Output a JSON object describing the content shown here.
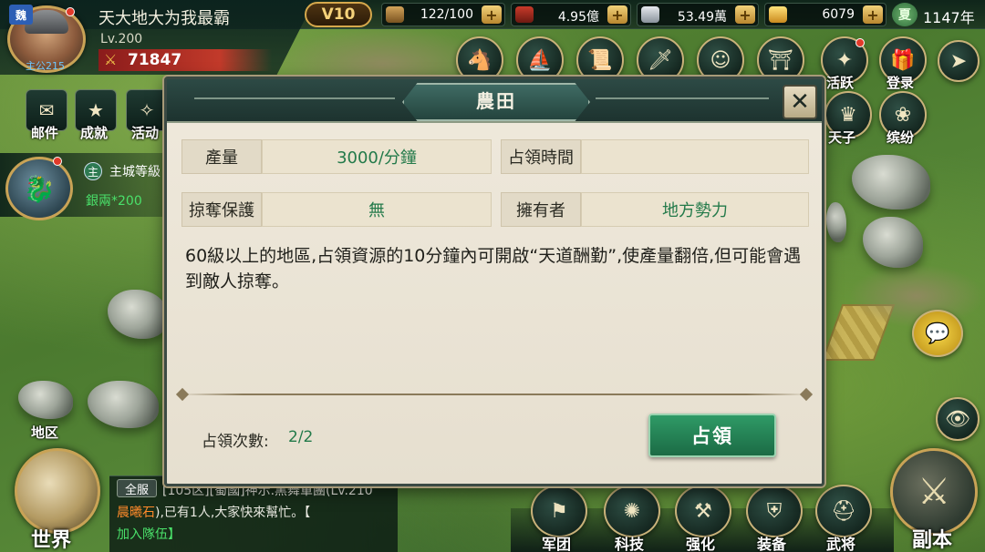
{
  "player": {
    "kingdom": "魏",
    "avatar_tag": "主公215",
    "name": "天大地大为我最霸",
    "level": "Lv.200",
    "power": "71847"
  },
  "resources": {
    "vip": "V10",
    "stamina": "122/100",
    "copper": "4.95億",
    "silver": "53.49萬",
    "gold": "6079",
    "season": "夏",
    "year": "1147年"
  },
  "top_icons": [
    {
      "name": "activity",
      "label": "活跃"
    },
    {
      "name": "login",
      "label": "登录"
    },
    {
      "name": "son-of-heaven",
      "label": "天子"
    },
    {
      "name": "colorful",
      "label": "缤纷"
    }
  ],
  "left_menu": [
    {
      "label": "邮件"
    },
    {
      "label": "成就"
    },
    {
      "label": "活动"
    }
  ],
  "quest": {
    "badge": "主",
    "title": "主城等級",
    "reward": "銀兩*200"
  },
  "region_label": "地区",
  "world_label": "世界",
  "dungeon_label": "副本",
  "chat": {
    "tab": "全服",
    "line1": "[105区][蜀國]神示.黑舞軍團(Lv.210",
    "line2_highlight": "晨曦石",
    "line2_rest": "),已有1人,大家快來幫忙。【",
    "line3": "加入隊伍】"
  },
  "bottom_nav": [
    {
      "label": "军团"
    },
    {
      "label": "科技"
    },
    {
      "label": "强化"
    },
    {
      "label": "装备"
    },
    {
      "label": "武将"
    }
  ],
  "dialog": {
    "title": "農田",
    "close_symbol": "✕",
    "rows": [
      {
        "label": "產量",
        "value": "3000/分鐘"
      },
      {
        "label": "占領時間",
        "value": ""
      },
      {
        "label": "掠奪保護",
        "value": "無"
      },
      {
        "label": "擁有者",
        "value": "地方勢力"
      }
    ],
    "description": "60級以上的地區,占領資源的10分鐘內可開啟“天道酬勤”,使產量翻倍,但可能會遇到敵人掠奪。",
    "occupy_count_label": "占領次數:",
    "occupy_count_value": "2/2",
    "occupy_button": "占領"
  },
  "colors": {
    "accent_green": "#237a4a",
    "button_green": "#2f9a66",
    "dialog_header": "#1d332f",
    "gold_border": "#c9a356"
  }
}
